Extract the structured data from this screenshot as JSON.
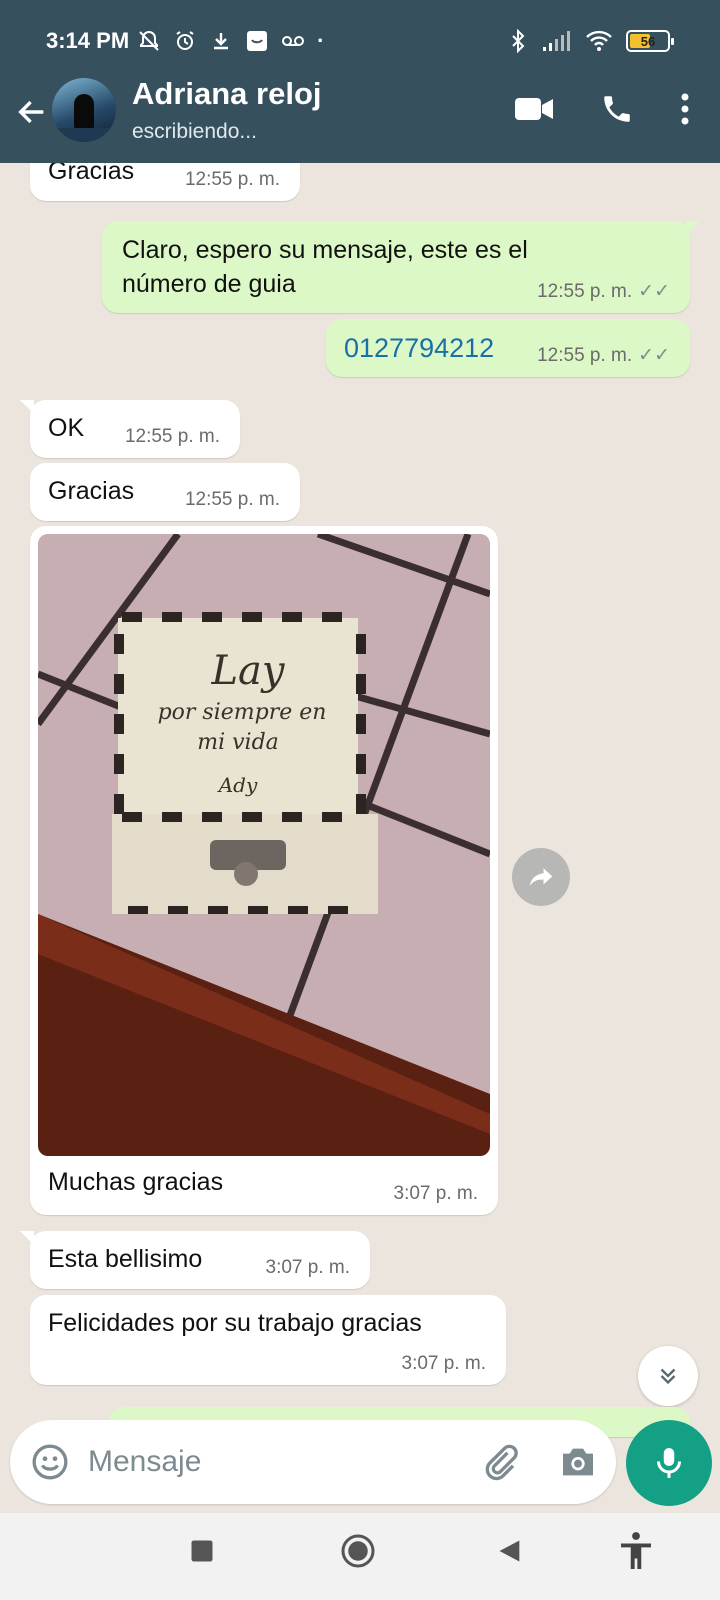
{
  "status_bar": {
    "time": "3:14 PM",
    "battery": "56"
  },
  "header": {
    "contact_name": "Adriana reloj",
    "contact_status": "escribiendo..."
  },
  "messages": [
    {
      "dir": "in",
      "text": "Gracias",
      "time": "12:55 p. m."
    },
    {
      "dir": "out",
      "text": "Claro, espero su mensaje, este es el número de guia",
      "time": "12:55 p. m."
    },
    {
      "dir": "out",
      "text": "0127794212",
      "time": "12:55 p. m."
    },
    {
      "dir": "in",
      "text": "OK",
      "time": "12:55 p. m."
    },
    {
      "dir": "in",
      "text": "Gracias",
      "time": "12:55 p. m."
    },
    {
      "dir": "in",
      "text": "Muchas gracias",
      "time": "3:07 p. m.",
      "photo": {
        "engraving_line1": "Lay",
        "engraving_line2": "por siempre en",
        "engraving_line3": "mi vida",
        "engraving_sign": "Ady"
      }
    },
    {
      "dir": "in",
      "text": "Esta bellisimo",
      "time": "3:07 p. m."
    },
    {
      "dir": "in",
      "text": "Felicidades por su trabajo gracias",
      "time": "3:07 p. m."
    }
  ],
  "composer": {
    "placeholder": "Mensaje"
  },
  "colors": {
    "header_bg": "#36505d",
    "chat_bg": "#ece5dd",
    "outgoing_bubble": "#dcf8c6",
    "incoming_bubble": "#ffffff",
    "mic_button": "#14a085",
    "link": "#1a6fa8"
  }
}
